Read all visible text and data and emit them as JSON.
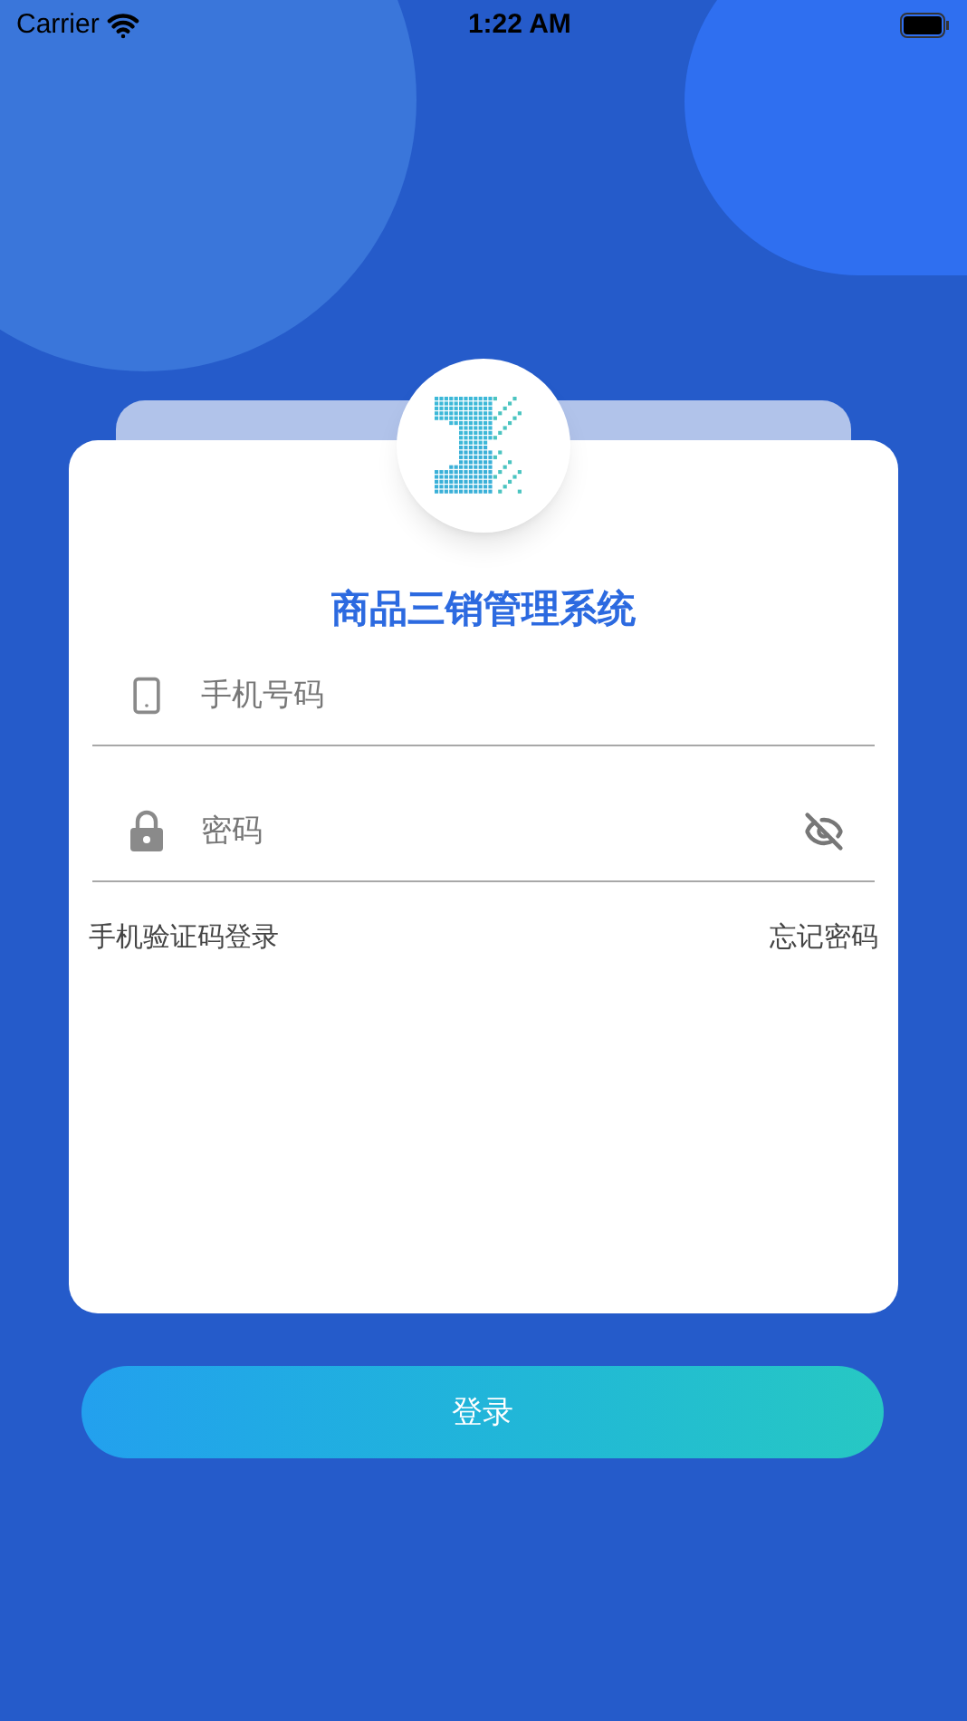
{
  "status_bar": {
    "carrier": "Carrier",
    "time": "1:22 AM"
  },
  "title": "商品三销管理系统",
  "fields": [
    {
      "kind": "phone",
      "placeholder": "手机号码"
    },
    {
      "kind": "password",
      "placeholder": "密码",
      "password_visible": false
    }
  ],
  "links": [
    "手机验证码登录",
    "忘记密码"
  ],
  "login_button": "登录"
}
